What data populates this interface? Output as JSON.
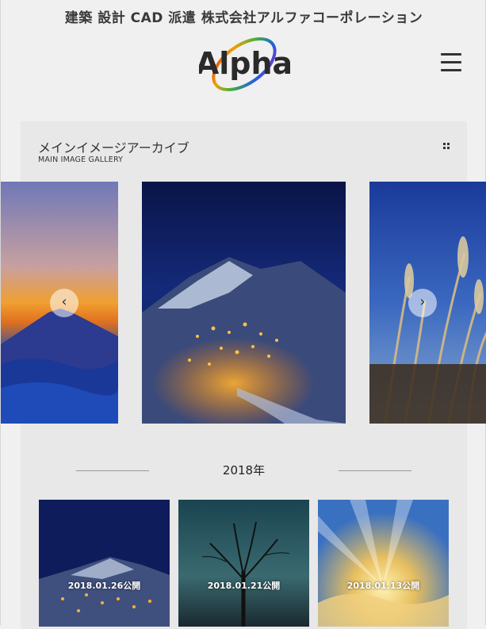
{
  "header": {
    "site_title": "建築 設計 CAD 派遣 株式会社アルファコーポレーション",
    "logo_text": "Alpha",
    "menu_icon": "hamburger-menu-icon"
  },
  "gallery": {
    "title": "メインイメージアーカイブ",
    "subtitle": "MAIN IMAGE GALLERY",
    "grid_icon": "grid-icon",
    "carousel": {
      "prev_label": "‹",
      "next_label": "›",
      "slides": [
        "mount-fuji-sunset",
        "snowy-village-night",
        "pampas-grass-sky"
      ]
    },
    "year": "2018年",
    "items": [
      {
        "date": "2018.01.26公開",
        "image": "snowy-village-night"
      },
      {
        "date": "2018.01.21公開",
        "image": "bare-tree-silhouette"
      },
      {
        "date": "2018.01.13公開",
        "image": "sun-rays-clouds"
      }
    ]
  },
  "colors": {
    "background": "#f0f0f0",
    "panel": "#e8e8e8",
    "text": "#222222"
  }
}
